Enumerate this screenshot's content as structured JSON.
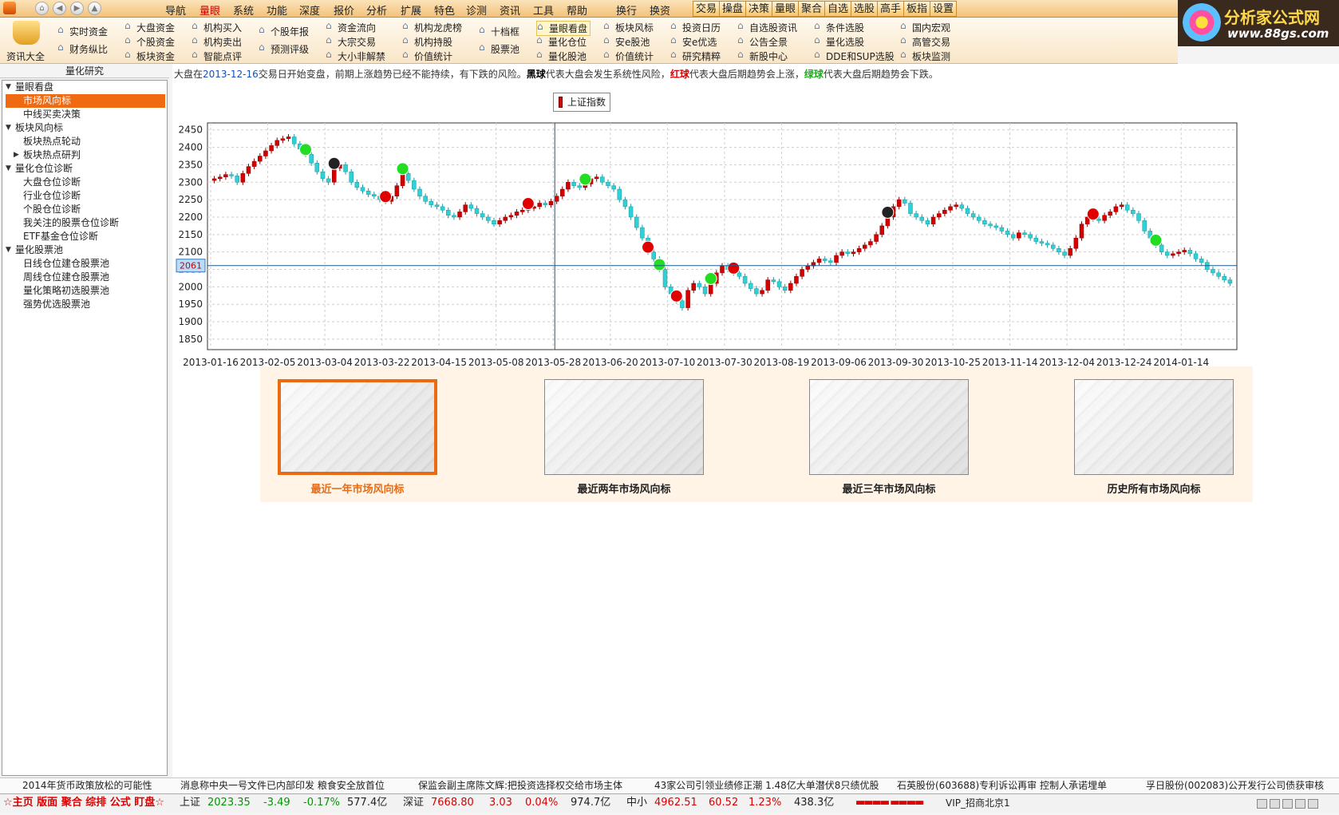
{
  "menubar": {
    "items": [
      "导航",
      "量眼",
      "系统",
      "功能",
      "深度",
      "报价",
      "分析",
      "扩展",
      "特色",
      "诊测",
      "资讯",
      "工具",
      "帮助",
      "换行",
      "换资"
    ],
    "active_index": 1,
    "buttons": [
      "交易",
      "操盘",
      "决策",
      "量眼",
      "聚合",
      "自选",
      "选股",
      "高手",
      "板指",
      "设置"
    ]
  },
  "brand": {
    "title": "分析家公式网",
    "url_text": "www.88gs.com"
  },
  "toolbar": {
    "big_label": "资讯大全",
    "cols": [
      [
        "实时资金",
        "财务纵比"
      ],
      [
        "大盘资金",
        "个股资金",
        "板块资金"
      ],
      [
        "机构买入",
        "机构卖出",
        "智能点评"
      ],
      [
        "个股年报",
        "预测评级"
      ],
      [
        "资金流向",
        "大宗交易",
        "大小非解禁"
      ],
      [
        "机构龙虎榜",
        "机构持股",
        "价值统计"
      ],
      [
        "十档框",
        "股票池"
      ],
      [
        "量眼看盘",
        "量化仓位",
        "量化股池"
      ],
      [
        "板块风标",
        "安e股池",
        "价值统计"
      ],
      [
        "投资日历",
        "安e优选",
        "研究精粹"
      ],
      [
        "自选股资讯",
        "公告全景",
        "新股中心"
      ],
      [
        "条件选股",
        "量化选股",
        "DDE和SUP选股"
      ],
      [
        "国内宏观",
        "高管交易",
        "板块监测"
      ]
    ]
  },
  "left_panel": {
    "header": "量化研究",
    "tree": [
      {
        "label": "量眼看盘",
        "level": 0,
        "expanded": true
      },
      {
        "label": "市场风向标",
        "level": 1,
        "selected": true
      },
      {
        "label": "中线买卖决策",
        "level": 1
      },
      {
        "label": "板块风向标",
        "level": 0,
        "expanded": true
      },
      {
        "label": "板块热点轮动",
        "level": 1
      },
      {
        "label": "板块热点研判",
        "level": 1,
        "collapsed": true
      },
      {
        "label": "量化仓位诊断",
        "level": 0,
        "expanded": true
      },
      {
        "label": "大盘仓位诊断",
        "level": 1
      },
      {
        "label": "行业仓位诊断",
        "level": 1
      },
      {
        "label": "个股仓位诊断",
        "level": 1
      },
      {
        "label": "我关注的股票仓位诊断",
        "level": 1
      },
      {
        "label": "ETF基金仓位诊断",
        "level": 1
      },
      {
        "label": "量化股票池",
        "level": 0,
        "expanded": true
      },
      {
        "label": "日线仓位建仓股票池",
        "level": 1
      },
      {
        "label": "周线仓位建仓股票池",
        "level": 1
      },
      {
        "label": "量化策略初选股票池",
        "level": 1
      },
      {
        "label": "强势优选股票池",
        "level": 1
      }
    ]
  },
  "tip": {
    "pre": "大盘在",
    "date": "2013-12-16",
    "mid": "交易日开始变盘，前期上涨趋势已经不能持续，有下跌的风险。",
    "black_ball": "黑球",
    "black_text": "代表大盘会发生系统性风险，",
    "red_ball": "红球",
    "red_text": "代表大盘后期趋势会上涨，",
    "green_ball": "绿球",
    "green_text": "代表大盘后期趋势会下跌。"
  },
  "legend": {
    "label": "上证指数"
  },
  "chart_data": {
    "type": "candlestick",
    "series_name": "上证指数",
    "ylim": [
      1820,
      2470
    ],
    "yticks": [
      2450,
      2400,
      2350,
      2300,
      2250,
      2200,
      2150,
      2100,
      2050,
      2000,
      1950,
      1900,
      1850
    ],
    "xtick_labels": [
      "2013-01-16",
      "2013-02-05",
      "2013-03-04",
      "2013-03-22",
      "2013-04-15",
      "2013-05-08",
      "2013-05-28",
      "2013-06-20",
      "2013-07-10",
      "2013-07-30",
      "2013-08-19",
      "2013-09-06",
      "2013-09-30",
      "2013-10-25",
      "2013-11-14",
      "2013-12-04",
      "2013-12-24",
      "2014-01-14"
    ],
    "crosshair_value": 2061,
    "crosshair_x_label": "2013-05-28",
    "close": [
      2310,
      2315,
      2322,
      2318,
      2300,
      2325,
      2345,
      2360,
      2375,
      2390,
      2405,
      2420,
      2425,
      2430,
      2410,
      2395,
      2380,
      2355,
      2330,
      2310,
      2300,
      2340,
      2350,
      2330,
      2300,
      2285,
      2275,
      2265,
      2260,
      2250,
      2245,
      2260,
      2290,
      2325,
      2305,
      2280,
      2260,
      2245,
      2235,
      2230,
      2220,
      2205,
      2200,
      2215,
      2235,
      2225,
      2210,
      2200,
      2190,
      2180,
      2190,
      2200,
      2205,
      2215,
      2220,
      2225,
      2230,
      2240,
      2235,
      2245,
      2260,
      2280,
      2300,
      2290,
      2285,
      2295,
      2310,
      2315,
      2300,
      2290,
      2280,
      2250,
      2230,
      2200,
      2170,
      2140,
      2100,
      2080,
      2050,
      2000,
      1980,
      1960,
      1940,
      1990,
      2010,
      2000,
      1980,
      2010,
      2040,
      2060,
      2050,
      2040,
      2030,
      2010,
      1995,
      1980,
      1990,
      2020,
      2015,
      2000,
      1990,
      2010,
      2030,
      2050,
      2060,
      2070,
      2080,
      2075,
      2070,
      2090,
      2100,
      2095,
      2100,
      2110,
      2120,
      2130,
      2150,
      2175,
      2200,
      2230,
      2250,
      2240,
      2210,
      2200,
      2190,
      2180,
      2200,
      2210,
      2220,
      2230,
      2235,
      2225,
      2210,
      2200,
      2190,
      2180,
      2175,
      2170,
      2160,
      2150,
      2140,
      2155,
      2150,
      2140,
      2130,
      2125,
      2120,
      2110,
      2100,
      2090,
      2110,
      2140,
      2180,
      2200,
      2195,
      2190,
      2205,
      2215,
      2230,
      2235,
      2220,
      2210,
      2190,
      2160,
      2140,
      2120,
      2100,
      2090,
      2095,
      2100,
      2105,
      2095,
      2080,
      2070,
      2050,
      2040,
      2030,
      2020,
      2010
    ],
    "markers": [
      {
        "index": 16,
        "color": "green"
      },
      {
        "index": 21,
        "color": "black"
      },
      {
        "index": 30,
        "color": "red"
      },
      {
        "index": 33,
        "color": "green"
      },
      {
        "index": 55,
        "color": "red"
      },
      {
        "index": 65,
        "color": "green"
      },
      {
        "index": 76,
        "color": "red"
      },
      {
        "index": 78,
        "color": "green"
      },
      {
        "index": 81,
        "color": "red"
      },
      {
        "index": 87,
        "color": "green"
      },
      {
        "index": 91,
        "color": "red"
      },
      {
        "index": 118,
        "color": "black"
      },
      {
        "index": 154,
        "color": "red"
      },
      {
        "index": 165,
        "color": "green"
      }
    ]
  },
  "thumbs": [
    {
      "label": "最近一年市场风向标",
      "selected": true
    },
    {
      "label": "最近两年市场风向标"
    },
    {
      "label": "最近三年市场风向标"
    },
    {
      "label": "历史所有市场风向标"
    }
  ],
  "news": [
    "2014年货币政策放松的可能性",
    "消息称中央一号文件已内部印发  粮食安全放首位",
    "保监会副主席陈文辉:把投资选择权交给市场主体",
    "43家公司引领业绩修正潮  1.48亿大单潜伏8只绩优股",
    "石英股份(603688)专利诉讼再审  控制人承诺埋单",
    "孚日股份(002083)公开发行公司债获审核"
  ],
  "status": {
    "left": "☆主页 版面 聚合 综排 公式 盯盘☆",
    "sh_name": "上证",
    "sh_price": "2023.35",
    "sh_chg": "-3.49",
    "sh_pct": "-0.17%",
    "sh_vol": "577.4亿",
    "sz_name": "深证",
    "sz_price": "7668.80",
    "sz_chg": "3.03",
    "sz_pct": "0.04%",
    "sz_vol": "974.7亿",
    "zx_name": "中小",
    "zx_price": "4962.51",
    "zx_chg": "60.52",
    "zx_pct": "1.23%",
    "zx_vol": "438.3亿",
    "vip": "VIP_招商北京1"
  }
}
